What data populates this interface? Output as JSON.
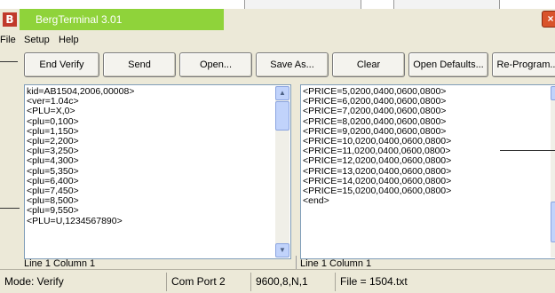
{
  "app": {
    "title": "BergTerminal 3.01",
    "icon_letter": "B"
  },
  "menu": [
    "File",
    "Setup",
    "Help"
  ],
  "toolbar": {
    "end_verify": "End Verify",
    "send": "Send",
    "open": "Open...",
    "save_as": "Save As...",
    "clear": "Clear",
    "open_defaults": "Open Defaults...",
    "reprogram": "Re-Program..."
  },
  "left_panel": {
    "text": "kid=AB1504,2006,00008>\n<ver=1.04c>\n<PLU=X,0>\n<plu=0,100>\n<plu=1,150>\n<plu=2,200>\n<plu=3,250>\n<plu=4,300>\n<plu=5,350>\n<plu=6,400>\n<plu=7,450>\n<plu=8,500>\n<plu=9,550>\n<PLU=U,1234567890>",
    "position": "Line 1 Column 1"
  },
  "right_panel": {
    "text": "<PRICE=5,0200,0400,0600,0800>\n<PRICE=6,0200,0400,0600,0800>\n<PRICE=7,0200,0400,0600,0800>\n<PRICE=8,0200,0400,0600,0800>\n<PRICE=9,0200,0400,0600,0800>\n<PRICE=10,0200,0400,0600,0800>\n<PRICE=11,0200,0400,0600,0800>\n<PRICE=12,0200,0400,0600,0800>\n<PRICE=13,0200,0400,0600,0800>\n<PRICE=14,0200,0400,0600,0800>\n<PRICE=15,0200,0400,0600,0800>\n<end>",
    "position": "Line 1 Column 1"
  },
  "status": {
    "mode": "Mode: Verify",
    "port": "Com Port 2",
    "settings": "9600,8,N,1",
    "file": "File = 1504.txt"
  },
  "colors": {
    "title_accent": "#8fd33a",
    "close": "#d9532b",
    "panel_border": "#7f9db9"
  }
}
